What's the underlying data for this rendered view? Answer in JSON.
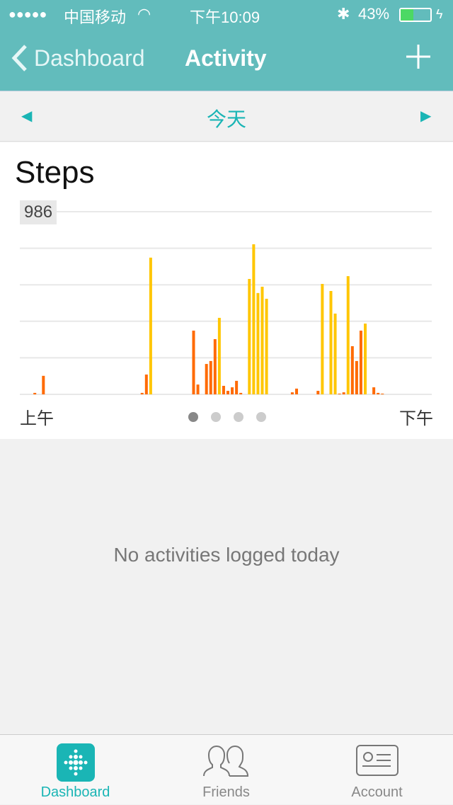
{
  "status": {
    "signal": "●●●●●",
    "carrier": "中国移动",
    "time": "下午10:09",
    "battery": "43%",
    "battery_level": 0.43
  },
  "nav": {
    "back_label": "Dashboard",
    "title": "Activity"
  },
  "datebar": {
    "date": "今天"
  },
  "card": {
    "title": "Steps",
    "x_start": "上午",
    "x_end": "下午",
    "page_count": 4,
    "active_page": 0
  },
  "chart_data": {
    "type": "bar",
    "title": "Steps",
    "ylim": [
      0,
      986
    ],
    "max_label": "986",
    "grid": true,
    "slots": 96,
    "colors": {
      "low": "#ff6a00",
      "high": "#ffc600"
    },
    "bars": [
      {
        "slot": 3,
        "value": 8,
        "level": "low"
      },
      {
        "slot": 5,
        "value": 100,
        "level": "low"
      },
      {
        "slot": 28,
        "value": 8,
        "level": "low"
      },
      {
        "slot": 29,
        "value": 107,
        "level": "low"
      },
      {
        "slot": 30,
        "value": 738,
        "level": "high"
      },
      {
        "slot": 40,
        "value": 344,
        "level": "low"
      },
      {
        "slot": 41,
        "value": 53,
        "level": "low"
      },
      {
        "slot": 43,
        "value": 164,
        "level": "low"
      },
      {
        "slot": 44,
        "value": 180,
        "level": "low"
      },
      {
        "slot": 45,
        "value": 298,
        "level": "low"
      },
      {
        "slot": 46,
        "value": 413,
        "level": "high"
      },
      {
        "slot": 47,
        "value": 46,
        "level": "low"
      },
      {
        "slot": 48,
        "value": 19,
        "level": "low"
      },
      {
        "slot": 49,
        "value": 38,
        "level": "low"
      },
      {
        "slot": 50,
        "value": 73,
        "level": "low"
      },
      {
        "slot": 51,
        "value": 8,
        "level": "low"
      },
      {
        "slot": 53,
        "value": 623,
        "level": "high"
      },
      {
        "slot": 54,
        "value": 810,
        "level": "high"
      },
      {
        "slot": 55,
        "value": 547,
        "level": "high"
      },
      {
        "slot": 56,
        "value": 581,
        "level": "high"
      },
      {
        "slot": 57,
        "value": 516,
        "level": "high"
      },
      {
        "slot": 63,
        "value": 11,
        "level": "low"
      },
      {
        "slot": 64,
        "value": 31,
        "level": "low"
      },
      {
        "slot": 69,
        "value": 19,
        "level": "low"
      },
      {
        "slot": 70,
        "value": 596,
        "level": "high"
      },
      {
        "slot": 72,
        "value": 558,
        "level": "high"
      },
      {
        "slot": 73,
        "value": 436,
        "level": "high"
      },
      {
        "slot": 74,
        "value": 4,
        "level": "low"
      },
      {
        "slot": 75,
        "value": 11,
        "level": "low"
      },
      {
        "slot": 76,
        "value": 638,
        "level": "high"
      },
      {
        "slot": 77,
        "value": 260,
        "level": "low"
      },
      {
        "slot": 78,
        "value": 180,
        "level": "low"
      },
      {
        "slot": 79,
        "value": 344,
        "level": "low"
      },
      {
        "slot": 80,
        "value": 382,
        "level": "high"
      },
      {
        "slot": 82,
        "value": 38,
        "level": "low"
      },
      {
        "slot": 83,
        "value": 8,
        "level": "low"
      },
      {
        "slot": 84,
        "value": 4,
        "level": "low"
      }
    ]
  },
  "empty_message": "No activities logged today",
  "tabs": [
    {
      "label": "Dashboard",
      "icon": "fitbit-logo-icon",
      "active": true
    },
    {
      "label": "Friends",
      "icon": "friends-icon",
      "active": false
    },
    {
      "label": "Account",
      "icon": "account-card-icon",
      "active": false
    }
  ],
  "accent": "#1ab5b5",
  "header_color": "#62bcbc"
}
